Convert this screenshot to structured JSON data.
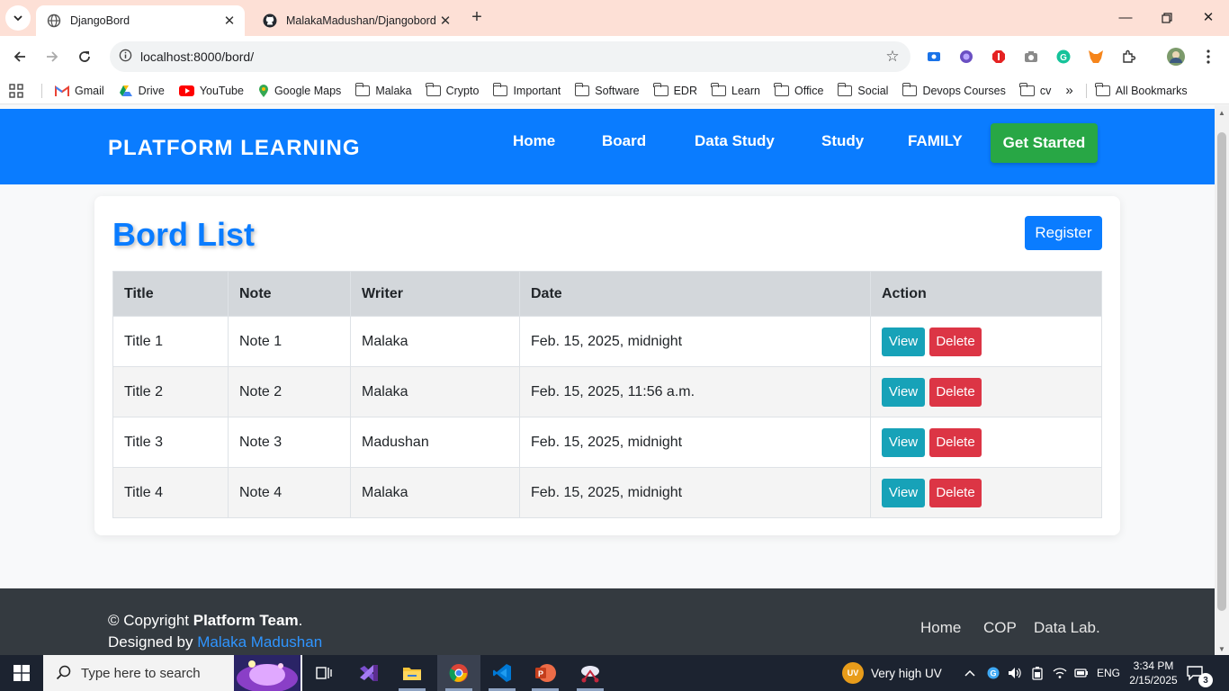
{
  "browser": {
    "tabs": [
      {
        "title": "DjangoBord"
      },
      {
        "title": "MalakaMadushan/Djangobord:"
      }
    ],
    "url": "localhost:8000/bord/",
    "bookmarks": [
      {
        "label": "Gmail",
        "icon": "gmail-icon"
      },
      {
        "label": "Drive",
        "icon": "drive-icon"
      },
      {
        "label": "YouTube",
        "icon": "youtube-icon"
      },
      {
        "label": "Google Maps",
        "icon": "maps-icon"
      },
      {
        "label": "Malaka",
        "icon": "folder-icon"
      },
      {
        "label": "Crypto",
        "icon": "folder-icon"
      },
      {
        "label": "Important",
        "icon": "folder-icon"
      },
      {
        "label": "Software",
        "icon": "folder-icon"
      },
      {
        "label": "EDR",
        "icon": "folder-icon"
      },
      {
        "label": "Learn",
        "icon": "folder-icon"
      },
      {
        "label": "Office",
        "icon": "folder-icon"
      },
      {
        "label": "Social",
        "icon": "folder-icon"
      },
      {
        "label": "Devops Courses",
        "icon": "folder-icon"
      },
      {
        "label": "cv",
        "icon": "folder-icon"
      }
    ],
    "overflow": "»",
    "all_bookmarks": "All Bookmarks"
  },
  "site": {
    "brand": "PLATFORM LEARNING",
    "nav": [
      "Home",
      "Board",
      "Data Study",
      "Study",
      "FAMILY"
    ],
    "cta": "Get Started"
  },
  "board": {
    "title": "Bord List",
    "register": "Register",
    "columns": [
      "Title",
      "Note",
      "Writer",
      "Date",
      "Action"
    ],
    "rows": [
      {
        "title": "Title 1",
        "note": "Note 1",
        "writer": "Malaka",
        "date": "Feb. 15, 2025, midnight"
      },
      {
        "title": "Title 2",
        "note": "Note 2",
        "writer": "Malaka",
        "date": "Feb. 15, 2025, 11:56 a.m."
      },
      {
        "title": "Title 3",
        "note": "Note 3",
        "writer": "Madushan",
        "date": "Feb. 15, 2025, midnight"
      },
      {
        "title": "Title 4",
        "note": "Note 4",
        "writer": "Malaka",
        "date": "Feb. 15, 2025, midnight"
      }
    ],
    "view_label": "View",
    "delete_label": "Delete"
  },
  "footer": {
    "copy_prefix": "© Copyright ",
    "team": "Platform Team",
    "copy_suffix": ".",
    "designed_prefix": "Designed by ",
    "designer": "Malaka Madushan",
    "links": [
      "Home",
      "COP",
      "Data Lab."
    ]
  },
  "taskbar": {
    "search_placeholder": "Type here to search",
    "weather_badge": "UV",
    "weather": "Very high UV",
    "lang": "ENG",
    "time": "3:34 PM",
    "date": "2/15/2025",
    "notifications": "3"
  },
  "colors": {
    "primary": "#0a7cff",
    "success": "#28a745",
    "info": "#17a2b8",
    "danger": "#dc3545",
    "footer": "#343a40"
  }
}
